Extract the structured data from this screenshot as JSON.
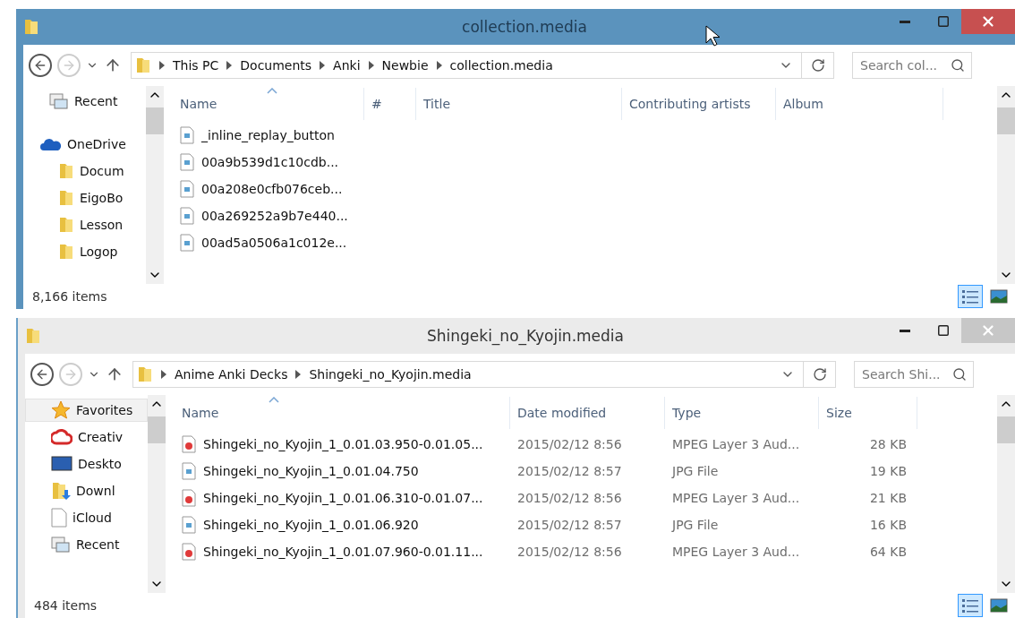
{
  "windows": [
    {
      "title": "collection.media",
      "active": true,
      "breadcrumb": [
        "This PC",
        "Documents",
        "Anki",
        "Newbie",
        "collection.media"
      ],
      "search": {
        "placeholder": "Search col..."
      },
      "sidebar": [
        {
          "label": "Recent",
          "kind": "recent",
          "selected": false
        },
        {
          "label": "OneDrive",
          "kind": "cloud",
          "selected": false
        },
        {
          "label": "Docum",
          "kind": "folder",
          "selected": false
        },
        {
          "label": "EigoBo",
          "kind": "folder",
          "selected": false
        },
        {
          "label": "Lesson",
          "kind": "folder",
          "selected": false
        },
        {
          "label": "Logop",
          "kind": "folder",
          "selected": false
        }
      ],
      "columns": [
        "Name",
        "#",
        "Title",
        "Contributing artists",
        "Album"
      ],
      "rows": [
        {
          "kind": "image",
          "cells": [
            "_inline_replay_button"
          ]
        },
        {
          "kind": "image",
          "cells": [
            "00a9b539d1c10cdb..."
          ]
        },
        {
          "kind": "image",
          "cells": [
            "00a208e0cfb076ceb..."
          ]
        },
        {
          "kind": "image",
          "cells": [
            "00a269252a9b7e440..."
          ]
        },
        {
          "kind": "image",
          "cells": [
            "00ad5a0506a1c012e..."
          ]
        }
      ],
      "status": "8,166 items",
      "views": [
        {
          "kind": "details",
          "selected": true
        },
        {
          "kind": "large",
          "selected": false
        }
      ]
    },
    {
      "title": "Shingeki_no_Kyojin.media",
      "active": false,
      "breadcrumb": [
        "Anime Anki Decks",
        "Shingeki_no_Kyojin.media"
      ],
      "search": {
        "placeholder": "Search Shi..."
      },
      "sidebar": [
        {
          "label": "Favorites",
          "kind": "star",
          "selected": true
        },
        {
          "label": "Creativ",
          "kind": "creative",
          "selected": false
        },
        {
          "label": "Deskto",
          "kind": "desktop",
          "selected": false
        },
        {
          "label": "Downl",
          "kind": "download",
          "selected": false
        },
        {
          "label": "iCloud",
          "kind": "page",
          "selected": false
        },
        {
          "label": "Recent",
          "kind": "recent",
          "selected": false
        }
      ],
      "columns": [
        "Name",
        "Date modified",
        "Type",
        "Size"
      ],
      "rows": [
        {
          "kind": "audio",
          "cells": [
            "Shingeki_no_Kyojin_1_0.01.03.950-0.01.05...",
            "2015/02/12 8:56",
            "MPEG Layer 3 Aud...",
            "28 KB"
          ]
        },
        {
          "kind": "image",
          "cells": [
            "Shingeki_no_Kyojin_1_0.01.04.750",
            "2015/02/12 8:57",
            "JPG File",
            "19 KB"
          ]
        },
        {
          "kind": "audio",
          "cells": [
            "Shingeki_no_Kyojin_1_0.01.06.310-0.01.07...",
            "2015/02/12 8:56",
            "MPEG Layer 3 Aud...",
            "21 KB"
          ]
        },
        {
          "kind": "image",
          "cells": [
            "Shingeki_no_Kyojin_1_0.01.06.920",
            "2015/02/12 8:57",
            "JPG File",
            "16 KB"
          ]
        },
        {
          "kind": "audio",
          "cells": [
            "Shingeki_no_Kyojin_1_0.01.07.960-0.01.11...",
            "2015/02/12 8:56",
            "MPEG Layer 3 Aud...",
            "64 KB"
          ]
        }
      ],
      "status": "484 items",
      "views": [
        {
          "kind": "details",
          "selected": true
        },
        {
          "kind": "large",
          "selected": false
        }
      ]
    }
  ]
}
